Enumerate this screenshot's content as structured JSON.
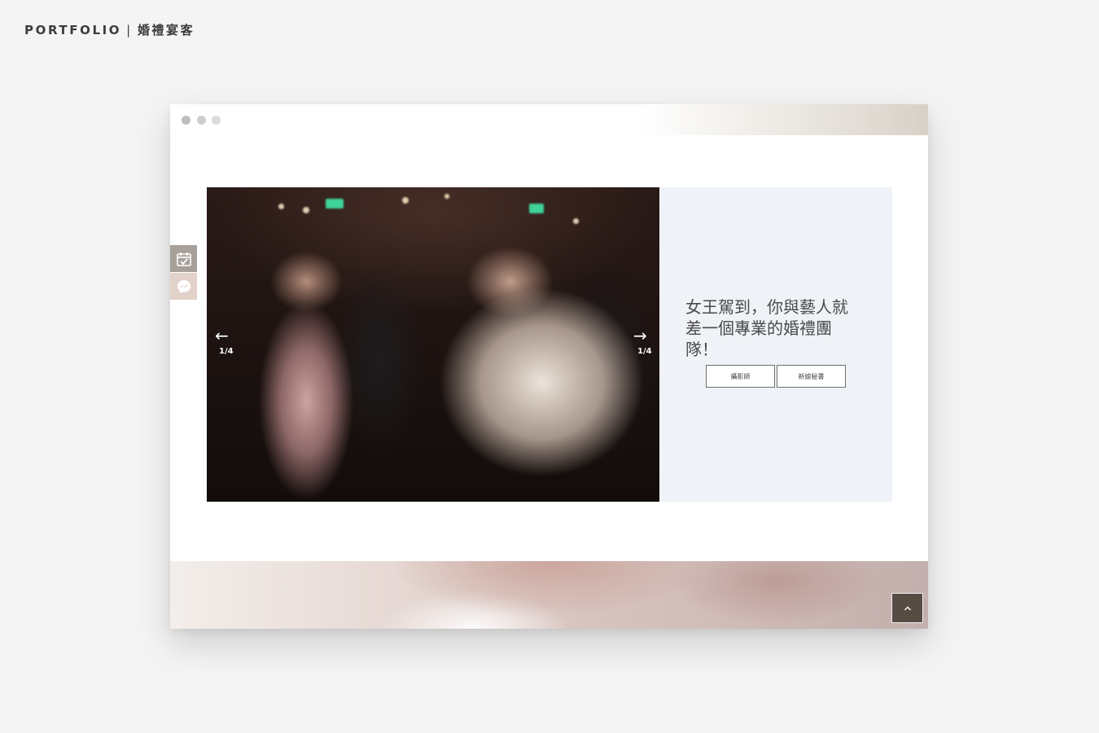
{
  "header": {
    "label": "PORTFOLIO",
    "separator": "|",
    "category": "婚禮宴客"
  },
  "browser": {
    "window_dots": [
      "dot-1",
      "dot-2",
      "dot-3"
    ]
  },
  "side_buttons": [
    {
      "icon": "calendar-check-icon"
    },
    {
      "icon": "messenger-icon"
    }
  ],
  "hero": {
    "slide_counter": "1/4",
    "heading": "女王駕到，你與藝人就差一個專業的婚禮團隊！",
    "buttons": [
      "攝影師",
      "新娘秘書"
    ]
  },
  "back_to_top": {
    "icon": "chevron-up-icon"
  },
  "colors": {
    "background": "#f4f4f4",
    "panel": "#eff2f6",
    "back_to_top": "#574c44"
  }
}
